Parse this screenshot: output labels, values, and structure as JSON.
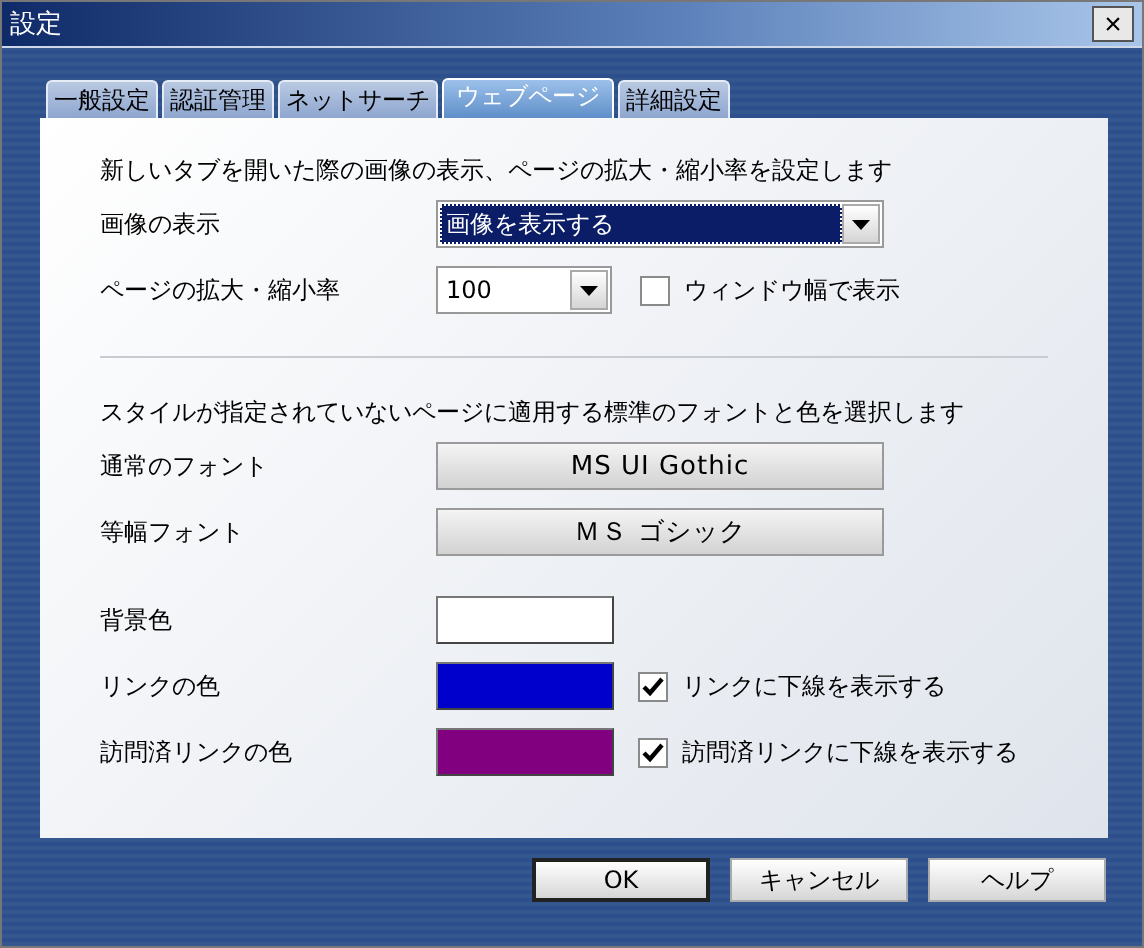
{
  "window": {
    "title": "設定",
    "close": "×"
  },
  "tabs": [
    {
      "label": "一般設定",
      "selected": false
    },
    {
      "label": "認証管理",
      "selected": false
    },
    {
      "label": "ネットサーチ",
      "selected": false
    },
    {
      "label": "ウェブページ",
      "selected": true
    },
    {
      "label": "詳細設定",
      "selected": false
    }
  ],
  "image_section": {
    "description": "新しいタブを開いた際の画像の表示、ページの拡大・縮小率を設定します",
    "image_display": {
      "label": "画像の表示",
      "value": "画像を表示する",
      "focused": true
    },
    "zoom": {
      "label": "ページの拡大・縮小率",
      "value": "100",
      "focused": false
    },
    "fit_window": {
      "label": "ウィンドウ幅で表示",
      "checked": false
    }
  },
  "font_section": {
    "description": "スタイルが指定されていないページに適用する標準のフォントと色を選択します",
    "fonts": [
      {
        "label": "通常のフォント",
        "value": "MS UI Gothic"
      },
      {
        "label": "等幅フォント",
        "value": "ＭＳ ゴシック"
      }
    ],
    "colors": [
      {
        "label": "背景色",
        "color": "#ffffff"
      },
      {
        "label": "リンクの色",
        "color": "#0000cc",
        "option": {
          "label": "リンクに下線を表示する",
          "checked": true
        }
      },
      {
        "label": "訪問済リンクの色",
        "color": "#800080",
        "option": {
          "label": "訪問済リンクに下線を表示する",
          "checked": true
        }
      }
    ]
  },
  "buttons": [
    {
      "label": "OK",
      "default": true
    },
    {
      "label": "キャンセル",
      "default": false
    },
    {
      "label": "ヘルプ",
      "default": false
    }
  ]
}
